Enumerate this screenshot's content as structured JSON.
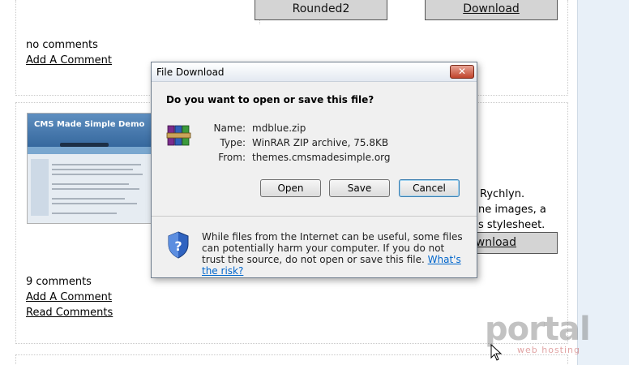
{
  "page": {
    "top_buttons": [
      "Rounded2",
      "Download"
    ],
    "top_comments": "no comments",
    "add_comment": "Add A Comment",
    "thumbnail_title": "CMS Made Simple Demo",
    "partial_text": [
      "Rychlyn.",
      "ne images, a",
      "s stylesheet."
    ],
    "partial_download": "wnload",
    "mid_comments": "9 comments",
    "add_comment_2": "Add A Comment",
    "read_comments": "Read Comments"
  },
  "dialog": {
    "title": "File Download",
    "close_glyph": "✕",
    "question": "Do you want to open or save this file?",
    "name_label": "Name:",
    "name_value": "mdblue.zip",
    "type_label": "Type:",
    "type_value": "WinRAR ZIP archive, 75.8KB",
    "from_label": "From:",
    "from_value": "themes.cmsmadesimple.org",
    "buttons": {
      "open": "Open",
      "save": "Save",
      "cancel": "Cancel"
    },
    "warning": "While files from the Internet can be useful, some files can potentially harm your computer. If you do not trust the source, do not open or save this file.",
    "risk_link": "What's the risk?",
    "file_icon": "winrar-archive-icon",
    "shield_icon": "security-shield-icon"
  },
  "watermark": {
    "main": "portal",
    "sub": "web hosting"
  },
  "colors": {
    "link_blue": "#0066cc",
    "close_red": "#c0442c",
    "panel_blue": "#e8f0f8"
  }
}
